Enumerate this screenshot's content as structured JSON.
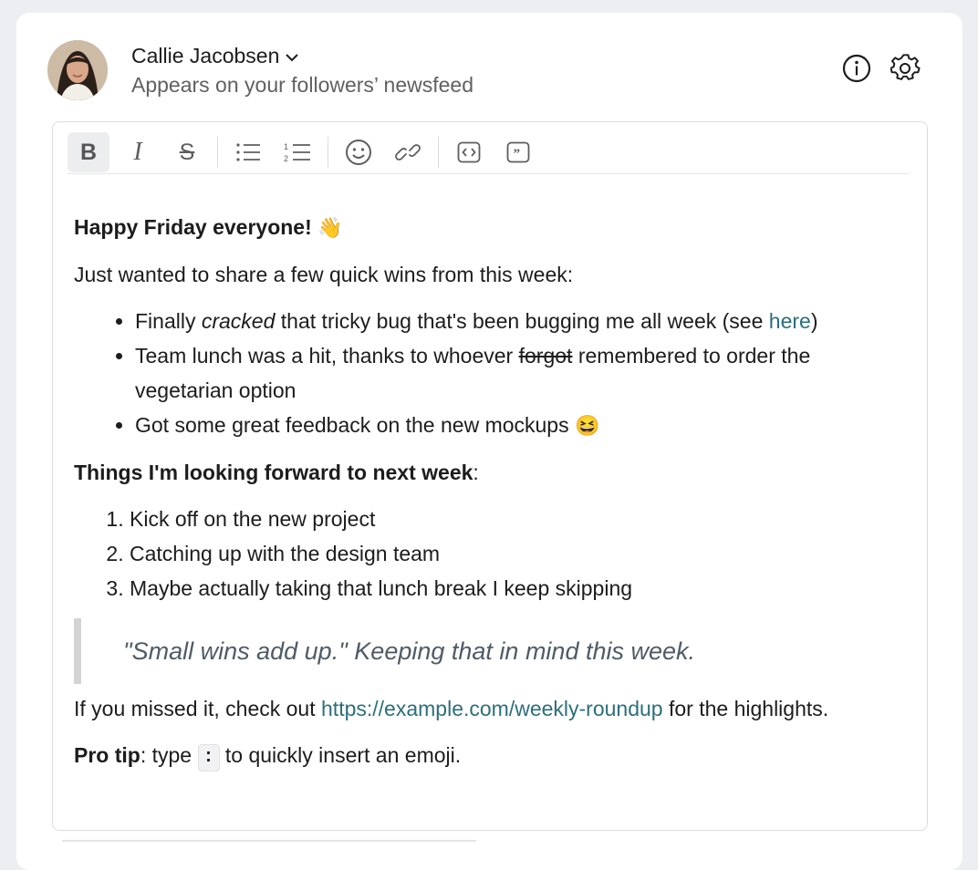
{
  "header": {
    "author_name": "Callie Jacobsen",
    "subtitle": "Appears on your followers’ newsfeed"
  },
  "icons": {
    "author_dropdown": "chevron-down-icon",
    "info": "info-icon",
    "settings": "gear-icon"
  },
  "toolbar": {
    "bold": "B",
    "italic": "I",
    "strike": "S",
    "buttons": [
      "bold",
      "italic",
      "strikethrough",
      "bulleted-list",
      "numbered-list",
      "emoji",
      "link",
      "code",
      "quote"
    ]
  },
  "post": {
    "heading": "Happy Friday everyone!",
    "heading_emoji": "👋",
    "intro": "Just wanted to share a few quick wins from this week:",
    "wins": {
      "item1_a": "Finally ",
      "item1_em": "cracked",
      "item1_b": " that tricky bug that's been bugging me all week (see ",
      "item1_link": "here",
      "item1_c": ")",
      "item2_a": "Team lunch was a hit, thanks to whoever ",
      "item2_strike": "forgot",
      "item2_b": " remembered to order the vegetarian option",
      "item3": "Got some great feedback on the new mockups ",
      "item3_emoji": "😆"
    },
    "next_heading": "Things I'm looking forward to next week",
    "next_colon": ":",
    "next_items": [
      "Kick off on the new project",
      "Catching up with the design team",
      "Maybe actually taking that lunch break I keep skipping"
    ],
    "quote_main": "\"Small wins add up.\"",
    "quote_rest": " Keeping that in mind this week.",
    "missed_a": "If you missed it, check out ",
    "missed_link": "https://example.com/weekly-roundup",
    "missed_b": " for the highlights.",
    "tip_label": "Pro tip",
    "tip_a": ": type ",
    "tip_code": ":",
    "tip_b": " to quickly insert an emoji."
  },
  "colors": {
    "link": "#2b6f7a",
    "active_toolbar_bg": "#ebedef",
    "quote_text": "#4f5b66"
  }
}
